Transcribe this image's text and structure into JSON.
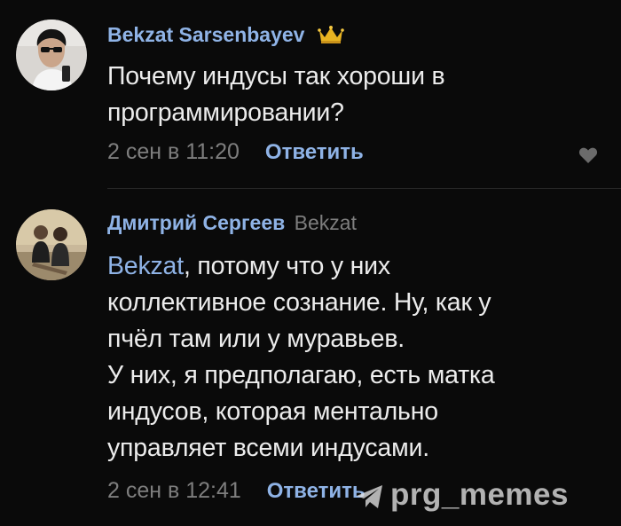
{
  "comments": [
    {
      "author": "Bekzat Sarsenbayev",
      "reply_to": "",
      "badge_icon": "crown-icon",
      "lines": [
        "Почему индусы так хороши в",
        "программировании?"
      ],
      "time": "2 сен в 11:20",
      "reply_label": "Ответить",
      "like_icon": "heart-icon"
    },
    {
      "author": "Дмитрий Сергеев",
      "reply_to": "Bekzat",
      "mention": "Bekzat",
      "first_line_rest": ", потому что у них",
      "lines": [
        "коллективное сознание. Ну, как у",
        "пчёл там или у муравьев.",
        "У них, я предполагаю, есть матка",
        "индусов, которая ментально",
        "управляет всеми индусами."
      ],
      "time": "2 сен в 12:41",
      "reply_label": "Ответить",
      "like_icon": "heart-icon"
    }
  ],
  "watermark": {
    "text": "prg_memes",
    "icon": "telegram-icon"
  },
  "colors": {
    "background": "#0a0a0a",
    "link": "#8fb3e6",
    "text": "#ececec",
    "muted": "#7e7e7e"
  }
}
